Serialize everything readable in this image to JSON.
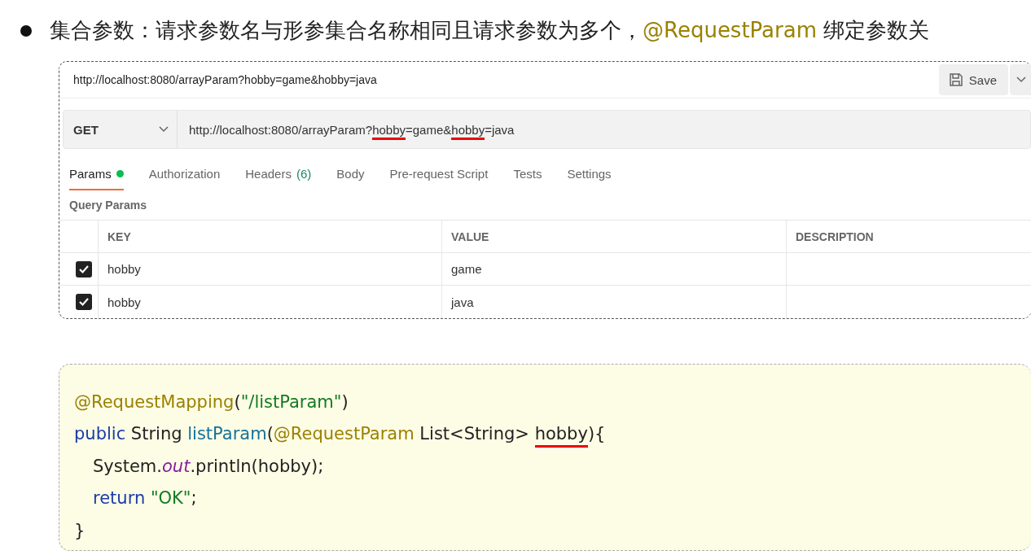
{
  "heading": {
    "segments": [
      {
        "text": "集合参数：请求参数名与形参集合名称相同且请求参数为多个，",
        "kind": "plain"
      },
      {
        "text": "@RequestParam",
        "kind": "annotation"
      },
      {
        "text": " 绑定参数关",
        "kind": "plain"
      }
    ]
  },
  "request": {
    "title": "http://localhost:8080/arrayParam?hobby=game&hobby=java",
    "save": "Save",
    "method": "GET",
    "url": [
      {
        "text": "http://localhost:8080/arrayParam?",
        "underlined": false
      },
      {
        "text": "hobby",
        "underlined": true
      },
      {
        "text": "=game&",
        "underlined": false
      },
      {
        "text": "hobby",
        "underlined": true
      },
      {
        "text": "=java",
        "underlined": false
      }
    ],
    "tabs": [
      {
        "label": "Params",
        "selected": true,
        "dot": true
      },
      {
        "label": "Authorization",
        "selected": false,
        "dot": false
      },
      {
        "label": "Headers",
        "count": "(6)",
        "selected": false,
        "dot": false
      },
      {
        "label": "Body",
        "selected": false,
        "dot": false
      },
      {
        "label": "Pre-request Script",
        "selected": false,
        "dot": false
      },
      {
        "label": "Tests",
        "selected": false,
        "dot": false
      },
      {
        "label": "Settings",
        "selected": false,
        "dot": false
      }
    ],
    "section": "Query Params",
    "columns": [
      "KEY",
      "VALUE",
      "DESCRIPTION"
    ],
    "rows": [
      {
        "checked": true,
        "key": "hobby",
        "value": "game"
      },
      {
        "checked": true,
        "key": "hobby",
        "value": "java"
      }
    ]
  },
  "code": [
    {
      "indent": false,
      "tokens": [
        {
          "text": "@RequestMapping",
          "kind": "annotation",
          "underlined": false
        },
        {
          "text": "(",
          "kind": "plain",
          "underlined": false
        },
        {
          "text": "\"/listParam\"",
          "kind": "string",
          "underlined": false
        },
        {
          "text": ")",
          "kind": "plain",
          "underlined": false
        }
      ]
    },
    {
      "indent": false,
      "tokens": [
        {
          "text": "public",
          "kind": "keyword",
          "underlined": false
        },
        {
          "text": " String ",
          "kind": "plain",
          "underlined": false
        },
        {
          "text": "listParam",
          "kind": "method",
          "underlined": false
        },
        {
          "text": "(",
          "kind": "plain",
          "underlined": false
        },
        {
          "text": "@RequestParam",
          "kind": "annotation",
          "underlined": false
        },
        {
          "text": " List<String> ",
          "kind": "plain",
          "underlined": false
        },
        {
          "text": "hobby",
          "kind": "plain",
          "underlined": true
        },
        {
          "text": "){",
          "kind": "plain",
          "underlined": false
        }
      ]
    },
    {
      "indent": true,
      "tokens": [
        {
          "text": "System.",
          "kind": "plain",
          "underlined": false
        },
        {
          "text": "out",
          "kind": "field",
          "underlined": false
        },
        {
          "text": ".println(hobby);",
          "kind": "plain",
          "underlined": false
        }
      ]
    },
    {
      "indent": true,
      "tokens": [
        {
          "text": "return ",
          "kind": "keyword",
          "underlined": false
        },
        {
          "text": "\"OK\"",
          "kind": "string",
          "underlined": false
        },
        {
          "text": ";",
          "kind": "plain",
          "underlined": false
        }
      ]
    },
    {
      "indent": false,
      "tokens": [
        {
          "text": "}",
          "kind": "plain",
          "underlined": false
        }
      ]
    }
  ]
}
